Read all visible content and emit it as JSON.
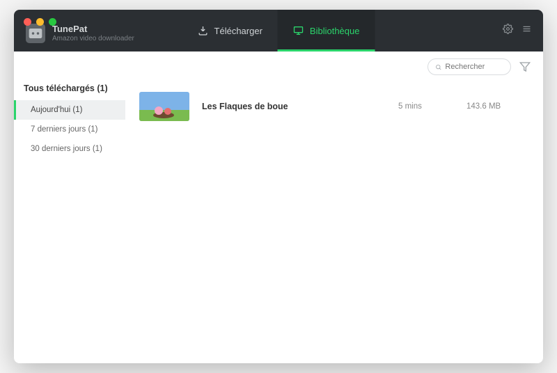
{
  "brand": {
    "name": "TunePat",
    "subtitle": "Amazon video downloader"
  },
  "tabs": {
    "download": "Télécharger",
    "library": "Bibliothèque"
  },
  "search": {
    "placeholder": "Rechercher"
  },
  "sidebar": {
    "header": "Tous téléchargés (1)",
    "items": [
      {
        "label": "Aujourd'hui (1)"
      },
      {
        "label": "7 derniers jours (1)"
      },
      {
        "label": "30 derniers jours (1)"
      }
    ]
  },
  "list": {
    "items": [
      {
        "title": "Les Flaques de boue",
        "duration": "5 mins",
        "size": "143.6 MB"
      }
    ]
  }
}
